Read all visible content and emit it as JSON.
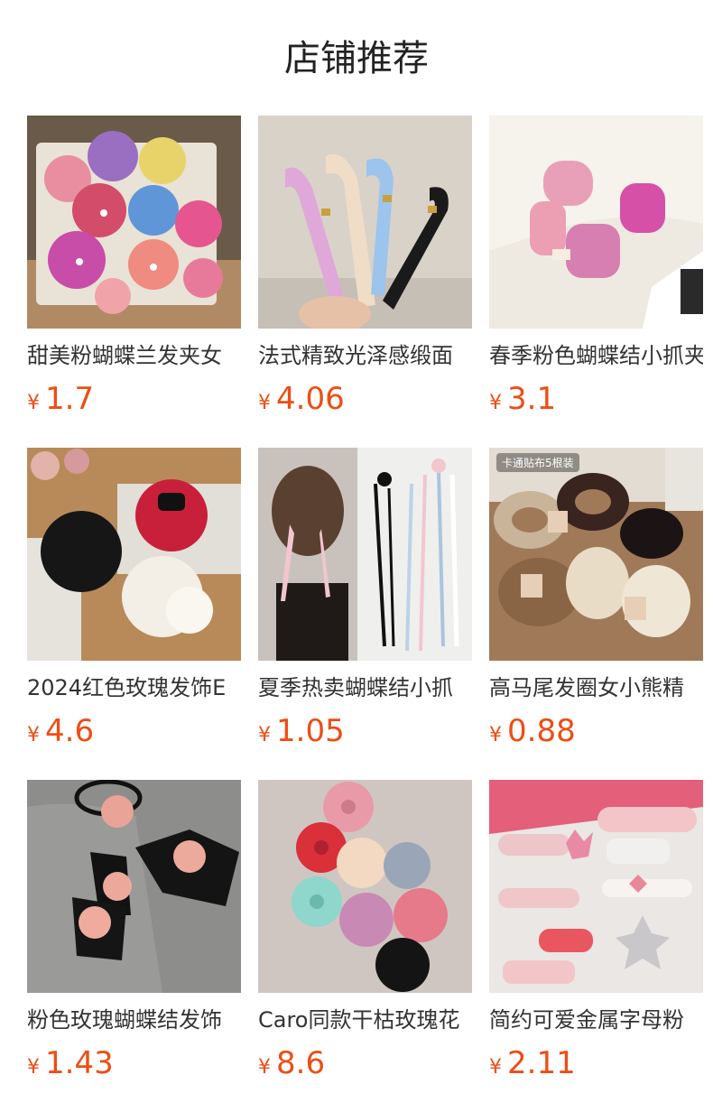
{
  "header": {
    "title": "店铺推荐"
  },
  "currency_symbol": "¥",
  "products": [
    {
      "title": "甜美粉蝴蝶兰发夹女",
      "price": "1.7",
      "image": "orchid-hair-clips-image"
    },
    {
      "title": "法式精致光泽感缎面",
      "price": "4.06",
      "image": "satin-headbands-image"
    },
    {
      "title": "春季粉色蝴蝶结小抓夹",
      "price": "3.1",
      "image": "pink-bow-claw-clips-image"
    },
    {
      "title": "2024红色玫瑰发饰E",
      "price": "4.6",
      "image": "rose-hair-accessories-image"
    },
    {
      "title": "夏季热卖蝴蝶结小抓",
      "price": "1.05",
      "image": "ribbon-bow-clips-image"
    },
    {
      "title": "高马尾发圈女小熊精",
      "price": "0.88",
      "image": "scrunchies-image",
      "tag": "卡通贴布5根装"
    },
    {
      "title": "粉色玫瑰蝴蝶结发饰",
      "price": "1.43",
      "image": "rose-bow-hair-ties-image"
    },
    {
      "title": "Caro同款干枯玫瑰花",
      "price": "8.6",
      "image": "camellia-flower-clips-image"
    },
    {
      "title": "简约可爱金属字母粉",
      "price": "2.11",
      "image": "pink-metal-letter-clips-image"
    }
  ]
}
